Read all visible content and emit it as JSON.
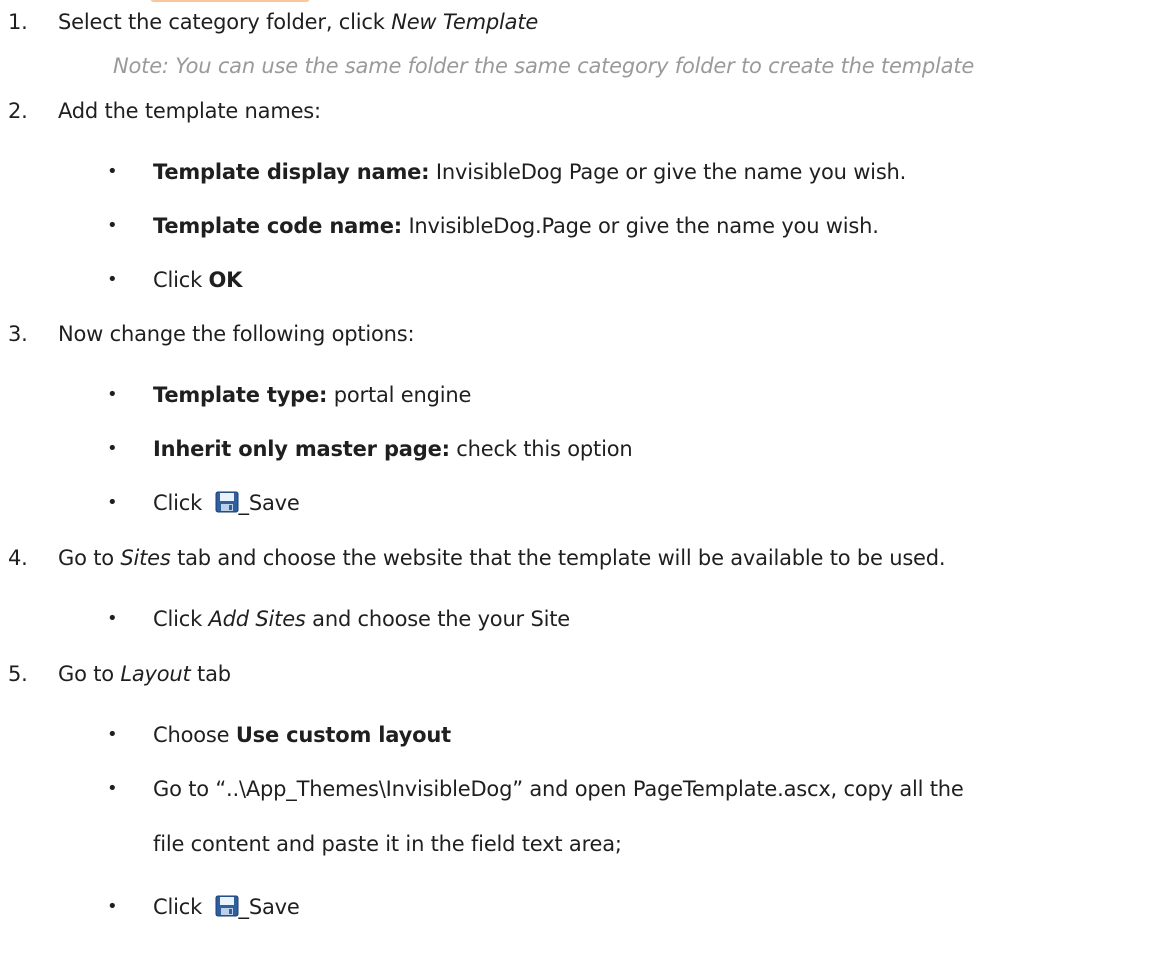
{
  "steps": [
    {
      "num": "1.",
      "pre": "Select the category folder, click ",
      "em": "New Template"
    },
    {
      "note": "Note: You can use the same folder the same category folder to create the template"
    },
    {
      "num": "2.",
      "text": "Add the template names:"
    },
    {
      "b_label": "Template display name:",
      "b_text": " InvisibleDog Page or give the name you wish."
    },
    {
      "b_label": "Template code name:",
      "b_text": " InvisibleDog.Page or give the name you wish."
    },
    {
      "pre": "Click ",
      "strong": "OK"
    },
    {
      "num": "3.",
      "text": "Now change the following options:"
    },
    {
      "b_label": "Template type:",
      "b_text": " portal engine"
    },
    {
      "b_label": "Inherit only master page:",
      "b_text": " check this option"
    },
    {
      "pre": "Click ",
      "after_icon": "_Save"
    },
    {
      "num": "4.",
      "pre": "Go to ",
      "em": "Sites",
      "post": " tab and choose the website that the template will be available to be used."
    },
    {
      "pre": "Click ",
      "em": "Add Sites",
      "post": " and choose the your Site"
    },
    {
      "num": "5.",
      "pre": "Go to ",
      "em": "Layout",
      "post": " tab"
    },
    {
      "pre": "Choose ",
      "strong": "Use custom layout"
    },
    {
      "text": "Go to “..\\App_Themes\\InvisibleDog” and open PageTemplate.ascx, copy all the"
    },
    {
      "text": "file content and paste it in the field text area;"
    },
    {
      "pre": "Click ",
      "after_icon": "_Save"
    }
  ],
  "bullet": "•",
  "icons": {
    "save": "floppy-disk-icon"
  }
}
